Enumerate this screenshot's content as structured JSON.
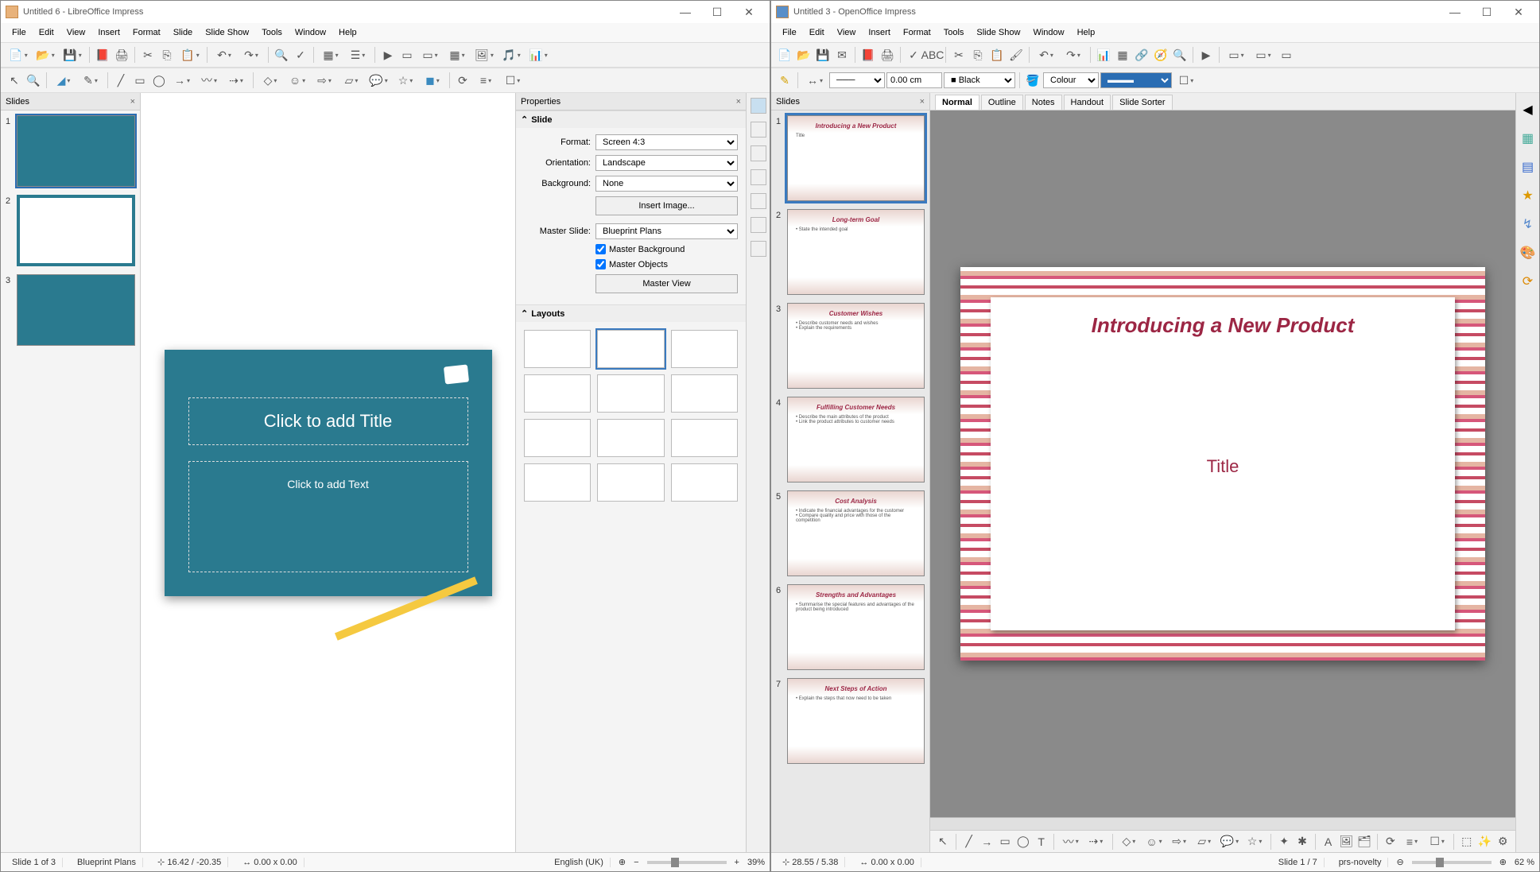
{
  "left": {
    "title": "Untitled 6 - LibreOffice Impress",
    "menu": [
      "File",
      "Edit",
      "View",
      "Insert",
      "Format",
      "Slide",
      "Slide Show",
      "Tools",
      "Window",
      "Help"
    ],
    "slides_panel_title": "Slides",
    "properties_title": "Properties",
    "section_slide": "Slide",
    "format_label": "Format:",
    "format_value": "Screen 4:3",
    "orientation_label": "Orientation:",
    "orientation_value": "Landscape",
    "background_label": "Background:",
    "background_value": "None",
    "insert_image": "Insert Image...",
    "master_slide_label": "Master Slide:",
    "master_slide_value": "Blueprint Plans",
    "master_bg": "Master Background",
    "master_obj": "Master Objects",
    "master_view": "Master View",
    "layouts_title": "Layouts",
    "editor_title_ph": "Click to add Title",
    "editor_text_ph": "Click to add Text",
    "status_slide": "Slide 1 of 3",
    "status_master": "Blueprint Plans",
    "status_coords": "16.42 / -20.35",
    "status_size": "0.00 x 0.00",
    "status_lang": "English (UK)",
    "status_zoom": "39%"
  },
  "right": {
    "title": "Untitled 3 - OpenOffice Impress",
    "menu": [
      "File",
      "Edit",
      "View",
      "Insert",
      "Format",
      "Tools",
      "Slide Show",
      "Window",
      "Help"
    ],
    "tb_measure": "0.00 cm",
    "tb_linecolor": "Black",
    "tb_fillcolor_label": "Colour",
    "slides_panel_title": "Slides",
    "view_tabs": [
      "Normal",
      "Outline",
      "Notes",
      "Handout",
      "Slide Sorter"
    ],
    "slides": [
      {
        "title": "Introducing a New Product",
        "body": "Title"
      },
      {
        "title": "Long-term Goal",
        "body": "• State the intended goal"
      },
      {
        "title": "Customer Wishes",
        "body": "• Describe customer needs and wishes\n• Explain the requirements"
      },
      {
        "title": "Fulfilling Customer Needs",
        "body": "• Describe the main attributes of the product\n• Link the product attributes to customer needs"
      },
      {
        "title": "Cost Analysis",
        "body": "• Indicate the financial advantages for the customer\n• Compare quality and price with those of the competition"
      },
      {
        "title": "Strengths and Advantages",
        "body": "• Summarise the special features and advantages of the product being introduced"
      },
      {
        "title": "Next Steps of Action",
        "body": "• Explain the steps that now need to be taken"
      }
    ],
    "main_title": "Introducing a New Product",
    "main_sub": "Title",
    "status_coords": "28.55 / 5.38",
    "status_size": "0.00 x 0.00",
    "status_slide": "Slide 1 / 7",
    "status_master": "prs-novelty",
    "status_zoom": "62 %"
  }
}
